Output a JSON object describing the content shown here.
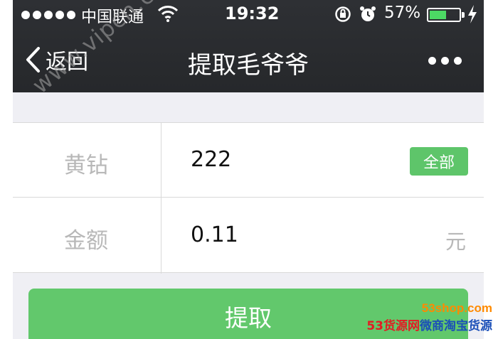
{
  "status_bar": {
    "carrier": "中国联通",
    "time": "19:32",
    "battery_percent": "57%",
    "battery_level": 0.57
  },
  "nav": {
    "back_label": "返回",
    "title": "提取毛爷爷"
  },
  "form": {
    "rows": [
      {
        "label": "黄钻",
        "value": "222",
        "action_label": "全部"
      },
      {
        "label": "金额",
        "value": "0.11",
        "unit": "元"
      }
    ]
  },
  "submit_label": "提取",
  "watermarks": {
    "diagonal": "www.vipcn.com",
    "corner_line1": "53shop.com",
    "corner_line2_a": "53货源网",
    "corner_line2_b": "微商淘宝货源"
  },
  "colors": {
    "accent_green": "#5ec56a",
    "topbar": "#2a2c30",
    "background": "#efeff4"
  }
}
